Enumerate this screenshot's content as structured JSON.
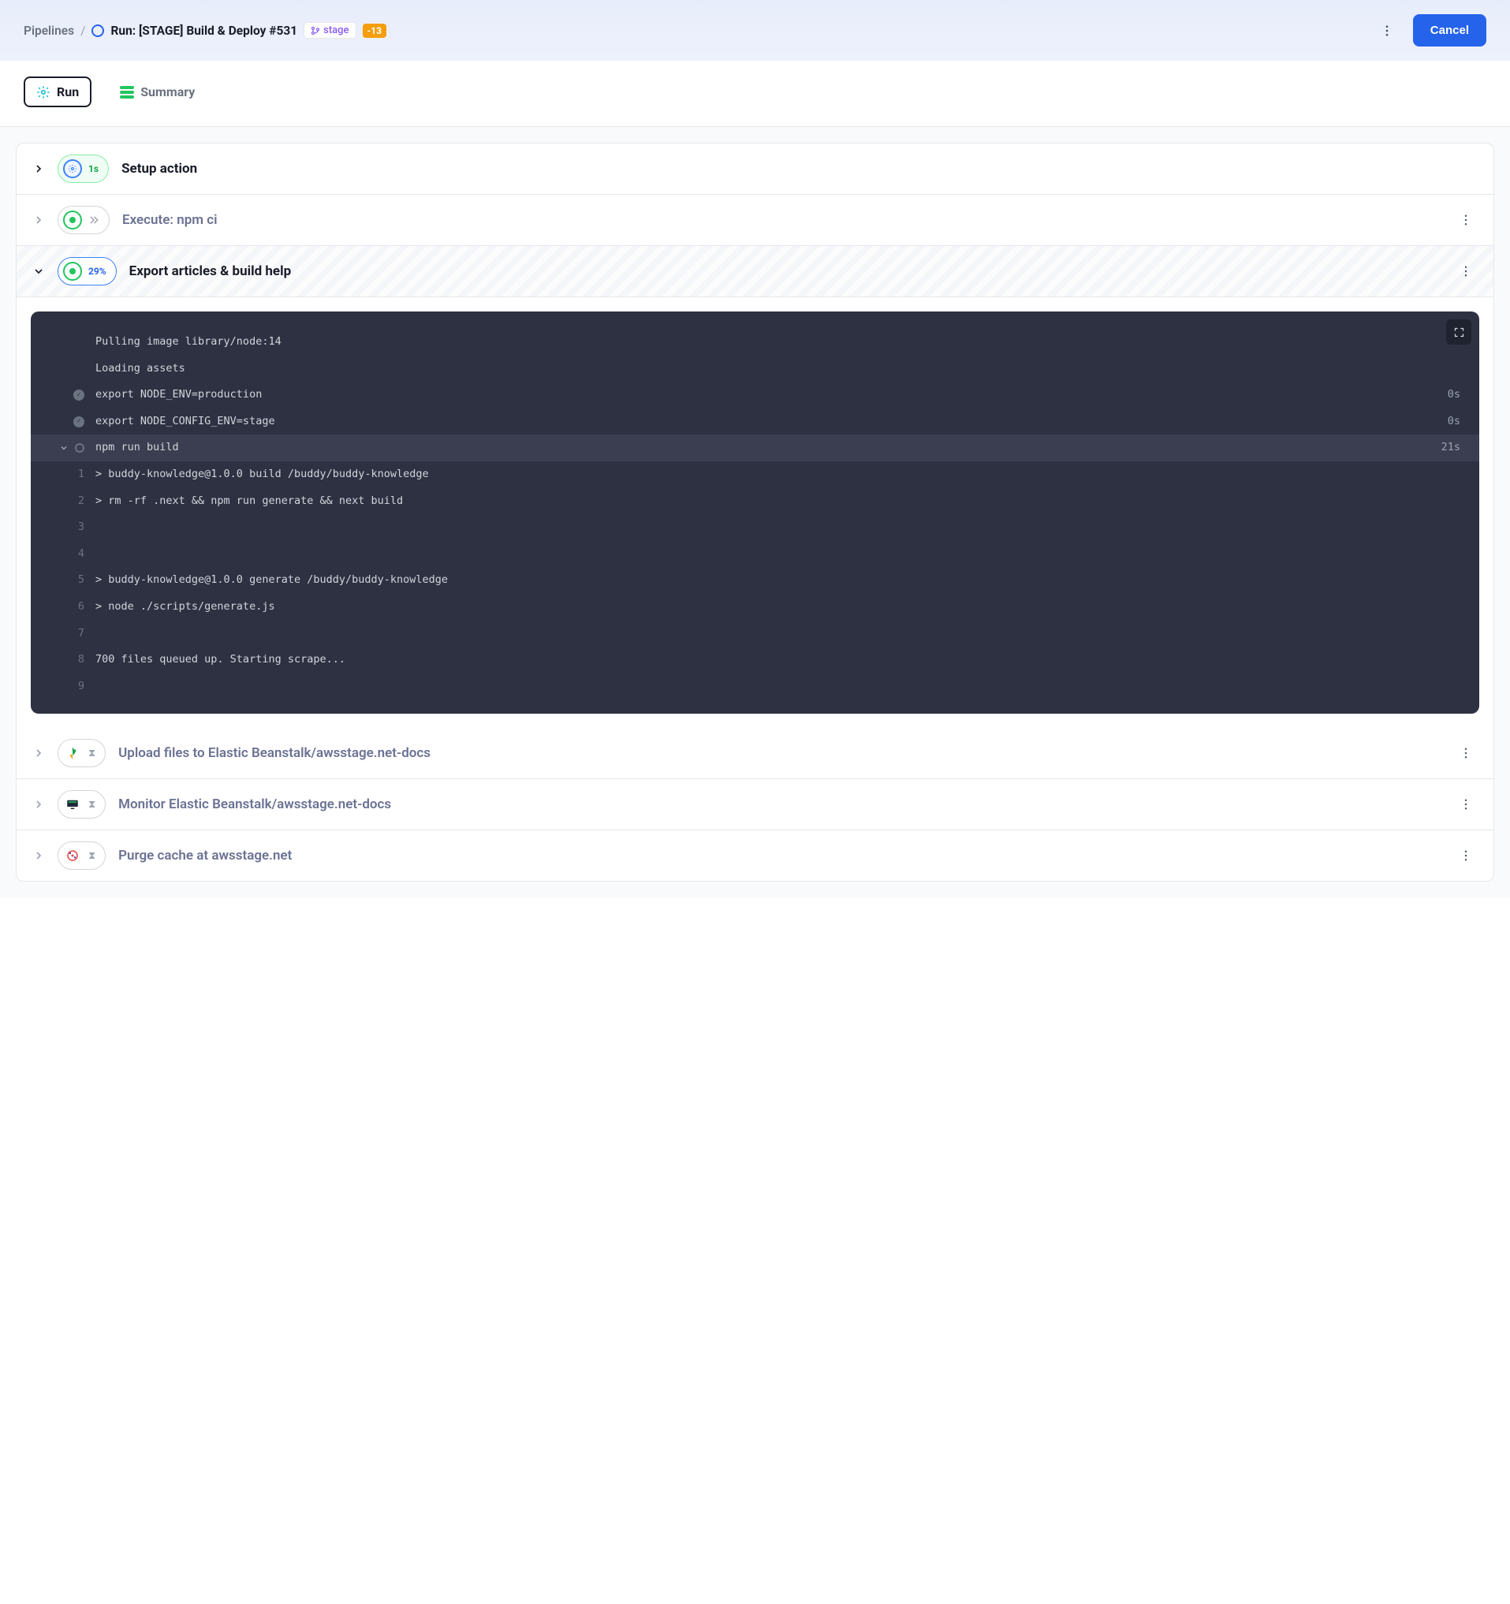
{
  "breadcrumb": {
    "root": "Pipelines",
    "current": "Run: [STAGE] Build & Deploy #531",
    "tag": "stage",
    "count": "-13"
  },
  "header": {
    "cancel": "Cancel"
  },
  "tabs": {
    "run": "Run",
    "summary": "Summary"
  },
  "actions": {
    "setup": {
      "title": "Setup action",
      "time": "1s"
    },
    "execute": {
      "title": "Execute: npm ci"
    },
    "export": {
      "title": "Export articles & build help",
      "progress": "29%"
    },
    "upload": {
      "title": "Upload files to Elastic Beanstalk/awsstage.net-docs"
    },
    "monitor": {
      "title": "Monitor Elastic Beanstalk/awsstage.net-docs"
    },
    "purge": {
      "title": "Purge cache at awsstage.net"
    }
  },
  "terminal": {
    "l_pull": "Pulling image library/node:14",
    "l_load": "Loading assets",
    "l_env1": {
      "text": "export NODE_ENV=production",
      "time": "0s"
    },
    "l_env2": {
      "text": "export NODE_CONFIG_ENV=stage",
      "time": "0s"
    },
    "l_run": {
      "text": "npm run build",
      "time": "21s"
    },
    "lines": {
      "1": "> buddy-knowledge@1.0.0 build /buddy/buddy-knowledge",
      "2": "> rm -rf .next && npm run generate && next build",
      "3": "",
      "4": "",
      "5": "> buddy-knowledge@1.0.0 generate /buddy/buddy-knowledge",
      "6": "> node ./scripts/generate.js",
      "7": "",
      "8": "700 files queued up. Starting scrape...",
      "9": ""
    }
  }
}
